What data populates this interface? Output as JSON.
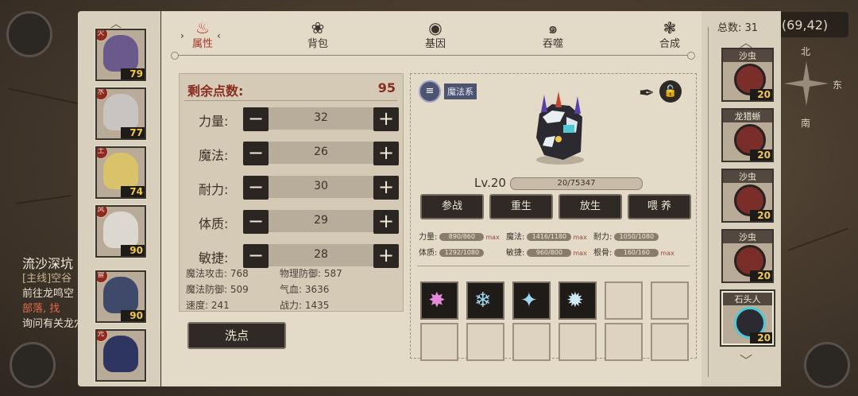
{
  "background": {
    "quest": {
      "title": "流沙深坑",
      "tag": "[主线]空谷",
      "lines": [
        "前往龙鸣空",
        "部落, 找",
        "询问有关龙穴"
      ]
    },
    "coord": "(69,42)",
    "compass": {
      "north": "北",
      "east": "东",
      "south": "南"
    }
  },
  "left_roster": [
    {
      "level": "79",
      "badge": "火",
      "color": "#6a5a8c"
    },
    {
      "level": "77",
      "badge": "水",
      "color": "#c9c4c2"
    },
    {
      "level": "74",
      "badge": "土",
      "color": "#d9c26a"
    },
    {
      "level": "90",
      "badge": "风",
      "color": "#dcd8d0"
    },
    {
      "level": "90",
      "badge": "雷",
      "color": "#3f4a6a"
    },
    {
      "level": "",
      "badge": "光",
      "color": "#2d3560"
    }
  ],
  "tabs": [
    {
      "label": "属性",
      "icon": "flame-icon",
      "glyph": "♨",
      "active": true
    },
    {
      "label": "背包",
      "icon": "bag-icon",
      "glyph": "❀"
    },
    {
      "label": "基因",
      "icon": "eye-icon",
      "glyph": "◉"
    },
    {
      "label": "吞噬",
      "icon": "swirl-icon",
      "glyph": "๑"
    },
    {
      "label": "合成",
      "icon": "merge-icon",
      "glyph": "❃"
    }
  ],
  "stats": {
    "remaining_label": "剩余点数:",
    "remaining_value": "95",
    "rows": [
      {
        "name": "力量:",
        "value": "32"
      },
      {
        "name": "魔法:",
        "value": "26"
      },
      {
        "name": "耐力:",
        "value": "30"
      },
      {
        "name": "体质:",
        "value": "29"
      },
      {
        "name": "敏捷:",
        "value": "28"
      }
    ],
    "derived": [
      {
        "label": "魔法攻击: 768"
      },
      {
        "label": "物理防御: 587"
      },
      {
        "label": "魔法防御: 509"
      },
      {
        "label": "气血: 3636"
      },
      {
        "label": "速度: 241"
      },
      {
        "label": "战力: 1435"
      }
    ],
    "wash_label": "洗点"
  },
  "pet": {
    "element": "魔法系",
    "level": "Lv.20",
    "exp": "20/75347",
    "actions": [
      "参战",
      "重生",
      "放生",
      "喂 养"
    ],
    "attributes": [
      {
        "name": "力量:",
        "value": "890/860",
        "max": "max"
      },
      {
        "name": "魔法:",
        "value": "1416/1180",
        "max": "max"
      },
      {
        "name": "耐力:",
        "value": "1050/1080",
        "max": ""
      },
      {
        "name": "体质:",
        "value": "1292/1080",
        "max": ""
      },
      {
        "name": "敏捷:",
        "value": "960/800",
        "max": "max"
      },
      {
        "name": "根骨:",
        "value": "160/160",
        "max": "max"
      }
    ],
    "skills": [
      {
        "icon": "pink-burst-icon",
        "glyph": "✸",
        "color": "#e48ad8"
      },
      {
        "icon": "ice-rock-icon",
        "glyph": "❄",
        "color": "#9fd7ec"
      },
      {
        "icon": "crystal-shell-icon",
        "glyph": "✦",
        "color": "#9fd7ec"
      },
      {
        "icon": "ice-star-icon",
        "glyph": "✹",
        "color": "#cfe9f5"
      }
    ]
  },
  "right_roster": {
    "total_label": "总数: 31",
    "pets": [
      {
        "name": "沙虫",
        "level": "20"
      },
      {
        "name": "龙猎蜥",
        "level": "20"
      },
      {
        "name": "沙虫",
        "level": "20"
      },
      {
        "name": "沙虫",
        "level": "20"
      },
      {
        "name": "石头人",
        "level": "20",
        "selected": true
      }
    ]
  }
}
